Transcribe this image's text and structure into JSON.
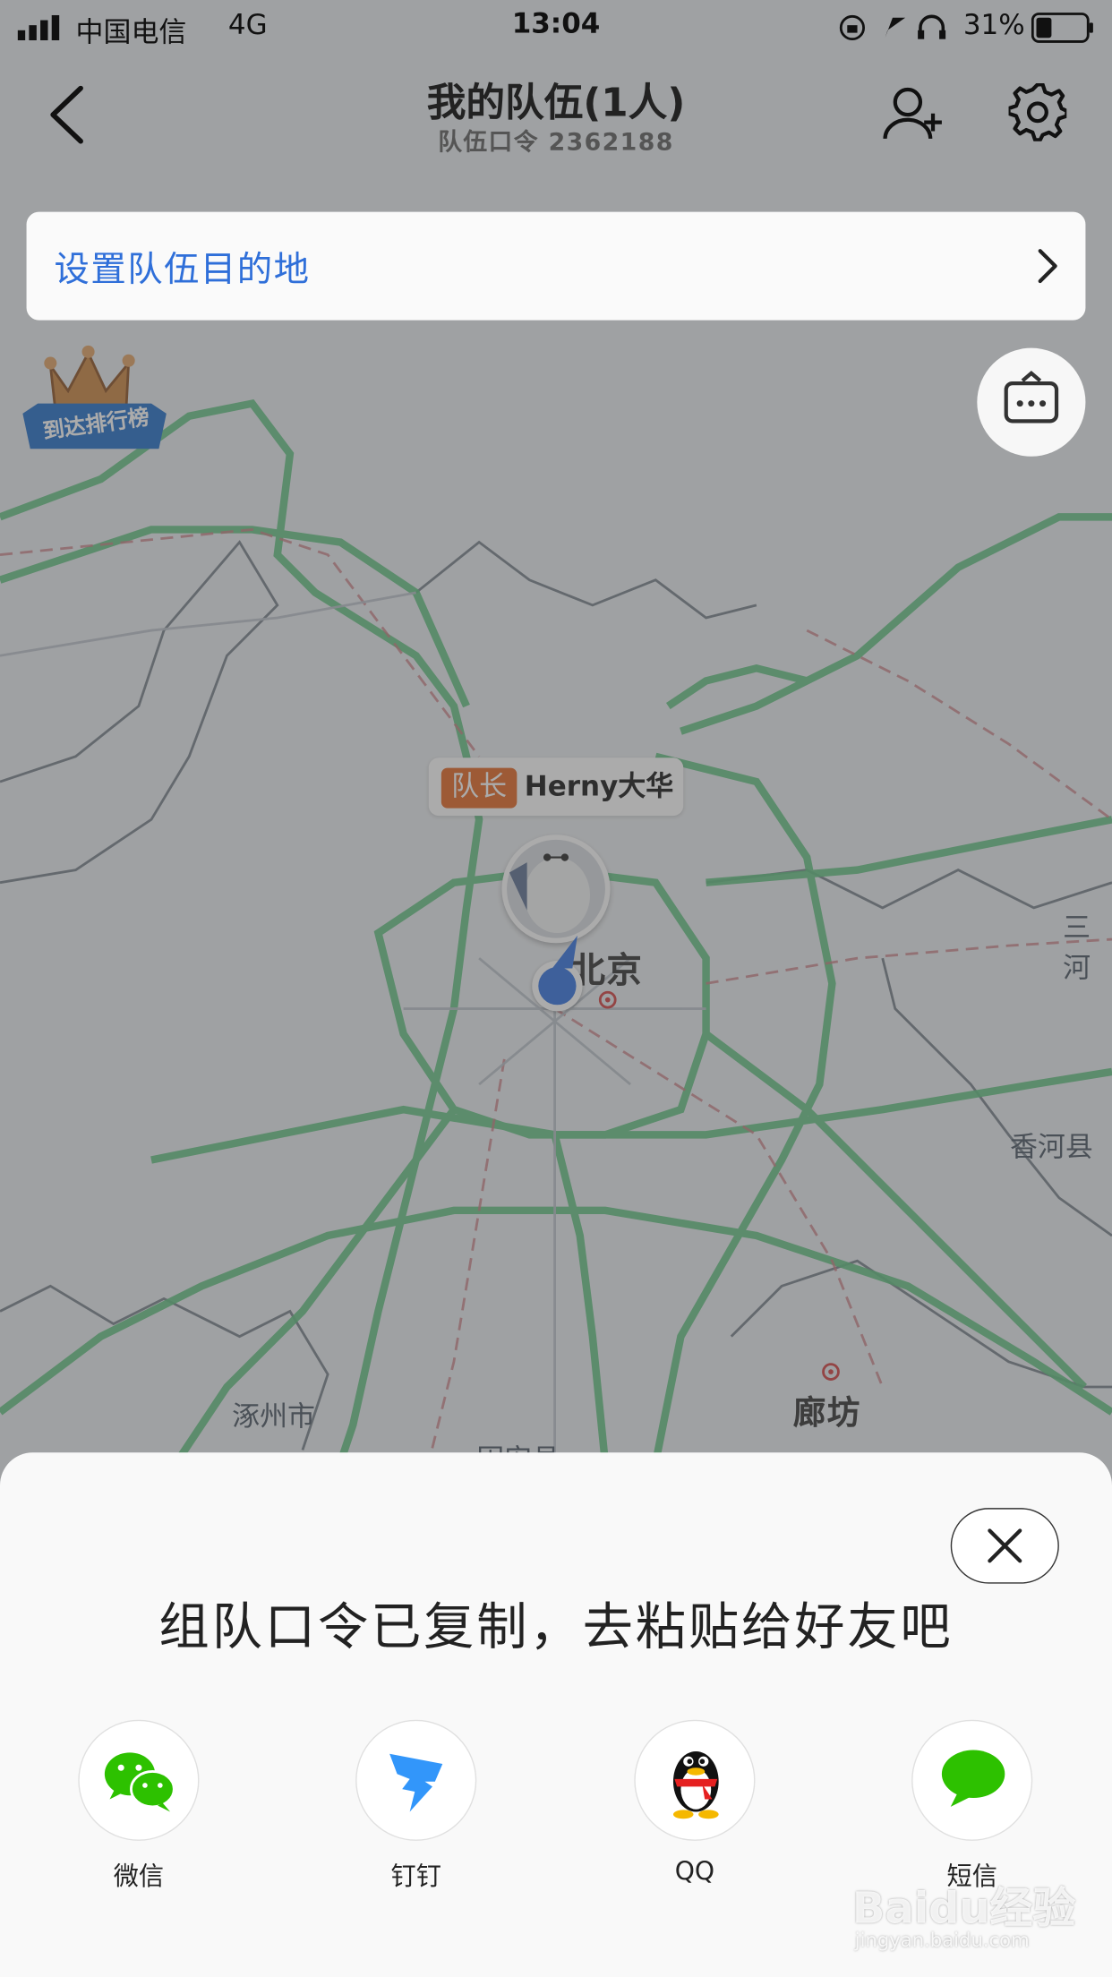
{
  "status_bar": {
    "carrier": "中国电信",
    "network": "4G",
    "time": "13:04",
    "battery": "31%"
  },
  "header": {
    "title": "我的队伍(1人)",
    "subtitle": "队伍口令 2362188",
    "back_icon": "chevron-left-icon",
    "add_member_icon": "add-user-icon",
    "settings_icon": "gear-icon"
  },
  "destination": {
    "label": "设置队伍目的地",
    "arrow_icon": "chevron-right-icon"
  },
  "ranking_badge": {
    "label": "到达排行榜"
  },
  "map": {
    "labels": [
      "北京",
      "三河",
      "香河县",
      "涿州市",
      "廊坊",
      "固安县"
    ]
  },
  "marker": {
    "role_badge": "队长",
    "name": "Herny大华"
  },
  "sheet": {
    "message": "组队口令已复制，去粘贴给好友吧",
    "close_icon": "close-icon",
    "share_options": [
      {
        "label": "微信",
        "icon": "wechat-icon"
      },
      {
        "label": "钉钉",
        "icon": "dingtalk-icon"
      },
      {
        "label": "QQ",
        "icon": "qq-icon"
      },
      {
        "label": "短信",
        "icon": "sms-icon"
      }
    ]
  },
  "watermark": {
    "brand": "Baidu经验",
    "url": "jingyan.baidu.com"
  },
  "colors": {
    "accent_blue": "#2f6fd9",
    "leader_badge": "#e46420",
    "road_green": "#48b46a",
    "wechat_green": "#2dc100",
    "dingtalk_blue": "#3296fa"
  }
}
